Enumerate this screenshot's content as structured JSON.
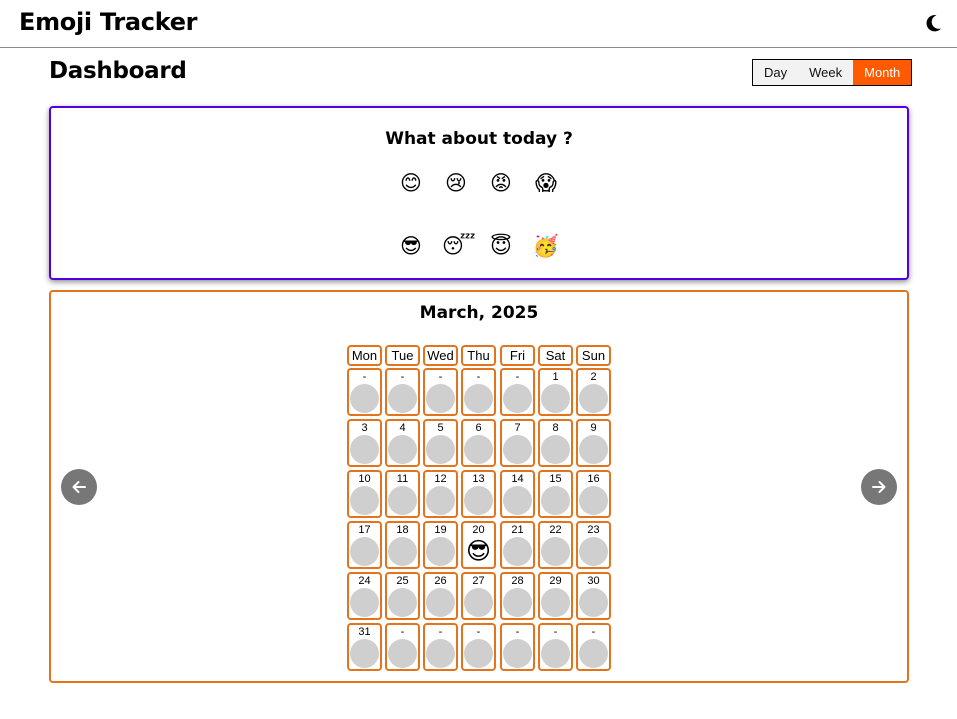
{
  "header": {
    "app_title": "Emoji Tracker",
    "theme_icon": "moon-icon"
  },
  "page": {
    "title": "Dashboard"
  },
  "range": {
    "options": [
      "Day",
      "Week",
      "Month"
    ],
    "active": "Month"
  },
  "today": {
    "title": "What about today ?",
    "emojis": [
      "😊",
      "😢",
      "😡",
      "😱",
      "😎",
      "😴",
      "😇",
      "🥳"
    ]
  },
  "calendar": {
    "title": "March, 2025",
    "weekdays": [
      "Mon",
      "Tue",
      "Wed",
      "Thu",
      "Fri",
      "Sat",
      "Sun"
    ],
    "days": [
      "-",
      "-",
      "-",
      "-",
      "-",
      "1",
      "2",
      "3",
      "4",
      "5",
      "6",
      "7",
      "8",
      "9",
      "10",
      "11",
      "12",
      "13",
      "14",
      "15",
      "16",
      "17",
      "18",
      "19",
      "20",
      "21",
      "22",
      "23",
      "24",
      "25",
      "26",
      "27",
      "28",
      "29",
      "30",
      "31",
      "-",
      "-",
      "-",
      "-",
      "-",
      "-"
    ],
    "entries": {
      "20": "😎"
    },
    "prev_icon": "arrow-left-icon",
    "next_icon": "arrow-right-icon"
  },
  "colors": {
    "accent": "#ff5a00",
    "today_border": "#5200e0",
    "calendar_border": "#e3741f",
    "empty_dot": "#cfcfcf",
    "nav_button": "#777777"
  }
}
